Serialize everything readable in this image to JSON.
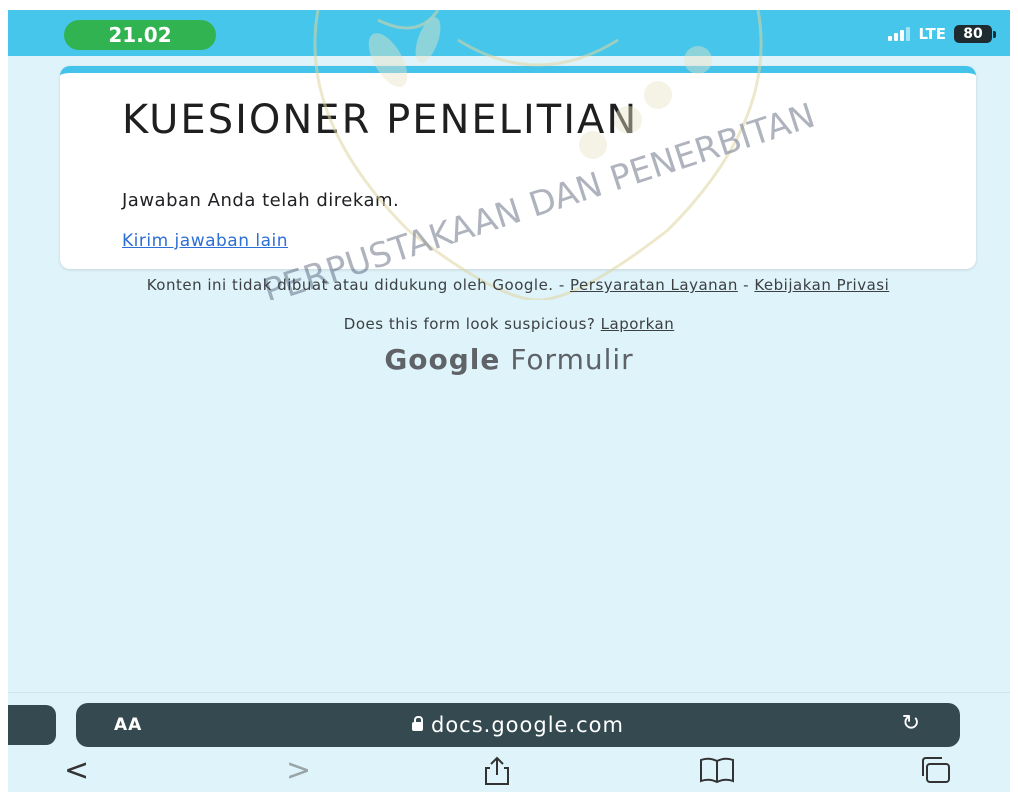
{
  "status": {
    "time": "21.02",
    "network": "LTE",
    "battery": "80"
  },
  "form": {
    "title": "KUESIONER PENELITIAN",
    "message": "Jawaban Anda telah direkam.",
    "link": "Kirim jawaban lain"
  },
  "footer": {
    "disclaimer": "Konten ini tidak dibuat atau didukung oleh Google. -",
    "terms": "Persyaratan Layanan",
    "sep": "-",
    "privacy": "Kebijakan Privasi",
    "suspicious": "Does this form look suspicious?",
    "report": "Laporkan",
    "brand_google": "Google",
    "brand_product": "Formulir"
  },
  "browser": {
    "aa": "AA",
    "url": "docs.google.com",
    "back": "<",
    "forward": ">"
  },
  "watermark": {
    "text": "PERPUSTAKAAN DAN PENERBITAN"
  },
  "colors": {
    "statusbar": "#45c6ea",
    "accent": "#43c2ea",
    "time_pill": "#31b351",
    "url_bar": "#344a50",
    "background": "#dff3fa",
    "link": "#2c6fd6"
  }
}
